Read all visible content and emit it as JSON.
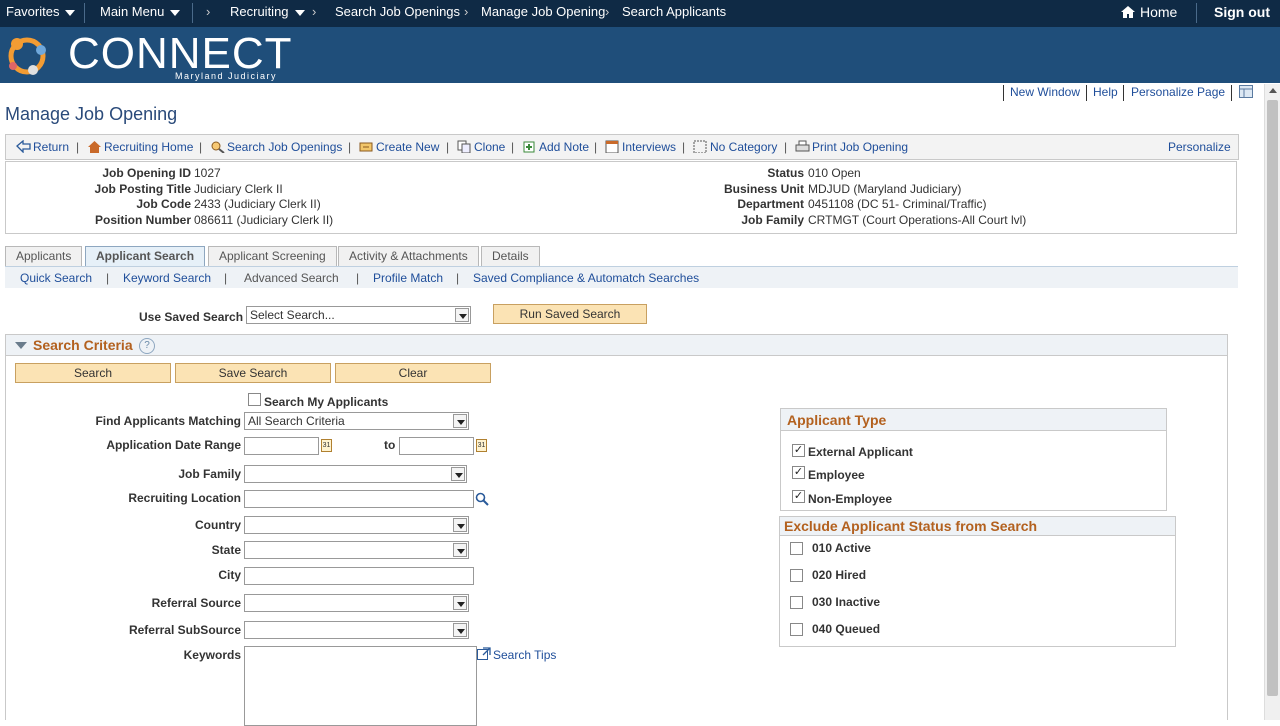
{
  "topnav": {
    "favorites": "Favorites",
    "main_menu": "Main Menu",
    "breadcrumb": [
      "Recruiting",
      "Search Job Openings",
      "Manage Job Opening",
      "Search Applicants"
    ],
    "home": "Home",
    "sign_out": "Sign out"
  },
  "banner": {
    "logo": "CONNECT",
    "subtitle": "Maryland Judiciary"
  },
  "utility_links": {
    "new_window": "New Window",
    "help": "Help",
    "personalize_page": "Personalize Page"
  },
  "page_title": "Manage Job Opening",
  "toolbar": {
    "items": [
      "Return",
      "Recruiting Home",
      "Search Job Openings",
      "Create New",
      "Clone",
      "Add Note",
      "Interviews",
      "No Category",
      "Print Job Opening"
    ],
    "personalize": "Personalize"
  },
  "job": {
    "left": [
      {
        "label": "Job Opening ID",
        "value": "1027"
      },
      {
        "label": "Job Posting Title",
        "value": "Judiciary Clerk II"
      },
      {
        "label": "Job Code",
        "value": "2433 (Judiciary Clerk II)"
      },
      {
        "label": "Position Number",
        "value": "086611 (Judiciary Clerk II)"
      }
    ],
    "right": [
      {
        "label": "Status",
        "value": "010 Open"
      },
      {
        "label": "Business Unit",
        "value": "MDJUD (Maryland Judiciary)"
      },
      {
        "label": "Department",
        "value": "0451108 (DC 51- Criminal/Traffic)"
      },
      {
        "label": "Job Family",
        "value": "CRTMGT (Court Operations-All Court lvl)"
      }
    ]
  },
  "tabs": [
    "Applicants",
    "Applicant Search",
    "Applicant Screening",
    "Activity & Attachments",
    "Details"
  ],
  "subnav": [
    "Quick Search",
    "Keyword Search",
    "Advanced Search",
    "Profile Match",
    "Saved Compliance & Automatch Searches"
  ],
  "saved_search": {
    "label": "Use Saved Search",
    "value": "Select Search...",
    "run_button": "Run Saved Search"
  },
  "criteria": {
    "title": "Search Criteria",
    "help": "?",
    "search_btn": "Search",
    "save_btn": "Save Search",
    "clear_btn": "Clear",
    "search_my_applicants": "Search My Applicants",
    "find_matching_label": "Find Applicants Matching",
    "find_matching_value": "All Search Criteria",
    "date_range_label": "Application Date Range",
    "to": "to",
    "cal_icon": "31",
    "job_family": "Job Family",
    "recruiting_location": "Recruiting Location",
    "country": "Country",
    "state": "State",
    "city": "City",
    "referral_source": "Referral Source",
    "referral_subsource": "Referral SubSource",
    "keywords": "Keywords",
    "search_tips": "Search Tips"
  },
  "applicant_type": {
    "title": "Applicant Type",
    "items": [
      {
        "label": "External Applicant",
        "checked": "✓"
      },
      {
        "label": "Employee",
        "checked": "✓"
      },
      {
        "label": "Non-Employee",
        "checked": "✓"
      }
    ]
  },
  "exclude_status": {
    "title": "Exclude Applicant Status from Search",
    "items": [
      "010 Active",
      "020 Hired",
      "030 Inactive",
      "040 Queued"
    ]
  }
}
